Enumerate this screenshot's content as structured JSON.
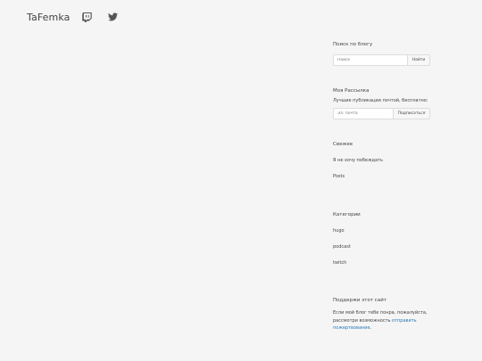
{
  "header": {
    "brand": "TaFemka",
    "icons": [
      "twitch-icon",
      "twitter-icon"
    ]
  },
  "search": {
    "title": "Поиск по блогу",
    "placeholder": "Поиск",
    "button": "Найти"
  },
  "newsletter": {
    "title": "Моя Рассылка",
    "description": "Лучшие публикации почтой, бесплатно:",
    "placeholder": "Эл. почта",
    "button": "Подписаться"
  },
  "recent": {
    "title": "Свежее",
    "items": [
      "Я не хочу побеждать",
      "Posts"
    ]
  },
  "categories": {
    "title": "Категории",
    "items": [
      "hugo",
      "podcast",
      "twitch"
    ]
  },
  "support": {
    "title": "Поддержи этот сайт",
    "text": "Если мой блог тебе понра, пожалуйста, рассмотри возможность ",
    "link": "отправить пожертвование",
    "text_end": "."
  },
  "colors": {
    "background": "#f5f5f5",
    "link": "#2a78b5",
    "text": "#444444"
  }
}
